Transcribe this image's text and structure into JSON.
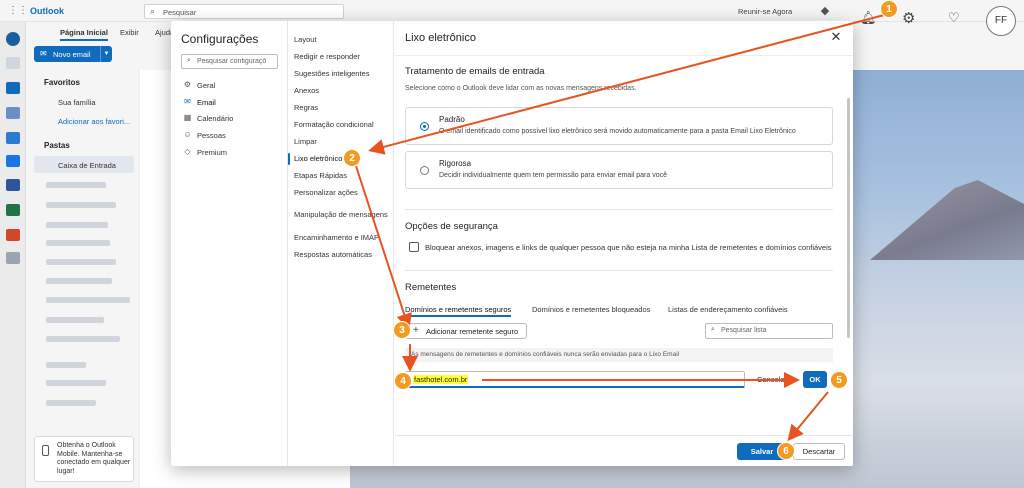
{
  "app": {
    "title": "Outlook",
    "search_placeholder": "Pesquisar",
    "meet_now": "Reunir-se Agora",
    "avatar_initials": "FF"
  },
  "ribbon": {
    "tabs": [
      "Página Inicial",
      "Exibir",
      "Ajuda"
    ],
    "new_mail": "Novo email"
  },
  "folders": {
    "favorites_header": "Favoritos",
    "family_group": "Sua família",
    "add_favorite": "Adicionar aos favori...",
    "folders_header": "Pastas",
    "inbox": "Caixa de Entrada",
    "promo": "Obtenha o Outlook Mobile. Mantenha-se conectado em qualquer lugar!"
  },
  "settings": {
    "title": "Configurações",
    "search_placeholder": "Pesquisar configuraçõ",
    "nav": [
      {
        "label": "Geral",
        "icon": "gear-icon"
      },
      {
        "label": "Email",
        "icon": "mail-icon"
      },
      {
        "label": "Calendário",
        "icon": "calendar-icon"
      },
      {
        "label": "Pessoas",
        "icon": "people-icon"
      },
      {
        "label": "Premium",
        "icon": "diamond-icon"
      }
    ],
    "sub": [
      "Layout",
      "Redigir e responder",
      "Sugestões inteligentes",
      "Anexos",
      "Regras",
      "Formatação condicional",
      "Limpar",
      "Lixo eletrônico",
      "Etapas Rápidas",
      "Personalizar ações",
      "Manipulação de mensagens",
      "Encaminhamento e IMAP",
      "Respostas automáticas"
    ],
    "main": {
      "title": "Lixo eletrônico",
      "incoming_header": "Tratamento de emails de entrada",
      "incoming_desc": "Selecione como o Outlook deve lidar com as novas mensagens recebidas.",
      "option_standard_title": "Padrão",
      "option_standard_desc": "O email identificado como possível lixo eletrônico será movido automaticamente para a pasta Email Lixo Eletrônico",
      "option_strict_title": "Rigorosa",
      "option_strict_desc": "Decidir individualmente quem tem permissão para enviar email para você",
      "security_header": "Opções de segurança",
      "security_checkbox": "Bloquear anexos, imagens e links de qualquer pessoa que não esteja na minha Lista de remetentes e domínios confiáveis",
      "senders_header": "Remetentes",
      "tabs": [
        "Domínios e remetentes seguros",
        "Domínios e remetentes bloqueados",
        "Listas de endereçamento confiáveis"
      ],
      "add_safe_sender": "Adicionar remetente seguro",
      "list_search_placeholder": "Pesquisar lista",
      "info_text": "As mensagens de remetentes e domínios confiáveis nunca serão enviadas para o Lixo Email",
      "entry_value": "fasthotel.com.br",
      "cancel": "Cancelar",
      "ok": "OK"
    },
    "save": "Salvar",
    "discard": "Descartar"
  },
  "annotations": {
    "steps": [
      "1",
      "2",
      "3",
      "4",
      "5",
      "6"
    ],
    "color": "#f39a22",
    "arrow_color": "#e8531f"
  }
}
